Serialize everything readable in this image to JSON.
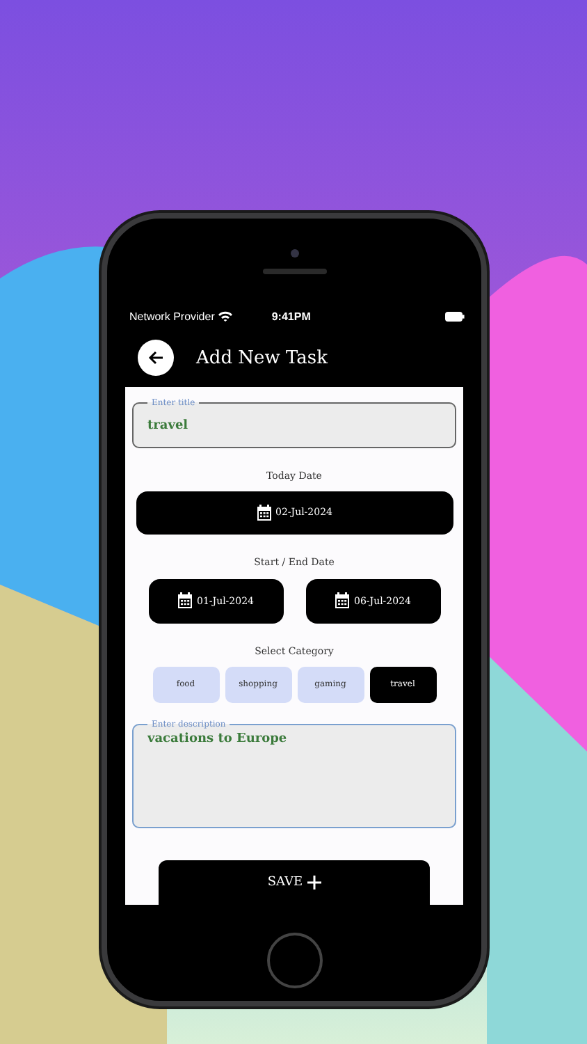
{
  "status_bar": {
    "carrier": "Network Provider",
    "time": "9:41PM"
  },
  "header": {
    "title": "Add New Task"
  },
  "title_field": {
    "label": "Enter title",
    "value": "travel"
  },
  "today": {
    "label": "Today Date",
    "date": "02-Jul-2024"
  },
  "range": {
    "label": "Start / End Date",
    "start": "01-Jul-2024",
    "end": "06-Jul-2024"
  },
  "category": {
    "label": "Select Category",
    "options": [
      {
        "label": "food",
        "selected": false
      },
      {
        "label": "shopping",
        "selected": false
      },
      {
        "label": "gaming",
        "selected": false
      },
      {
        "label": "travel",
        "selected": true
      }
    ]
  },
  "description_field": {
    "label": "Enter description",
    "value": "vacations to Europe"
  },
  "save_button": {
    "label": "SAVE"
  }
}
